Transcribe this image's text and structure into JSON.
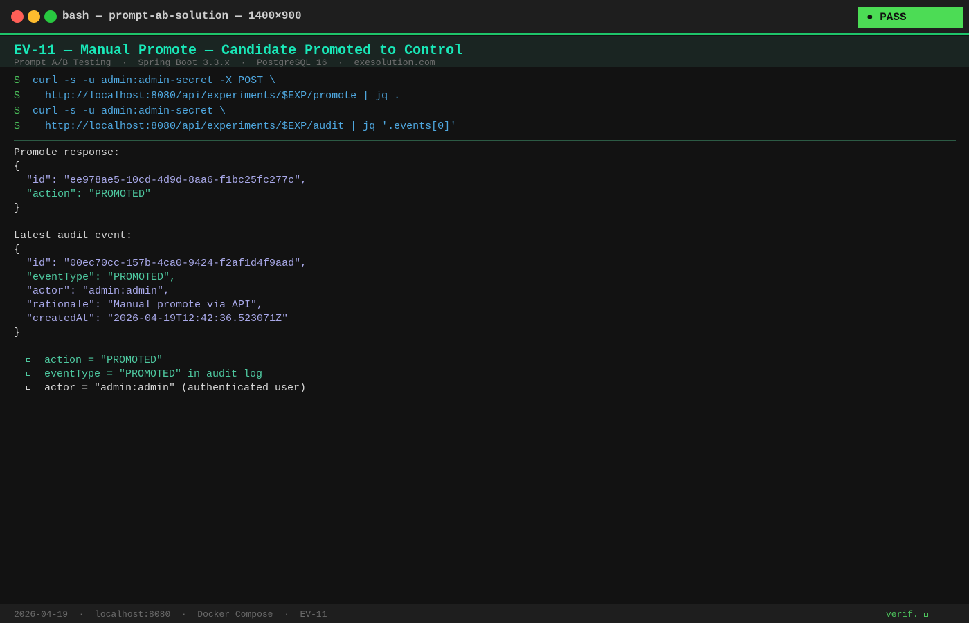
{
  "window": {
    "title": "bash — prompt-ab-solution — 1400×900",
    "status": "PASS"
  },
  "header": {
    "title": "EV-11 — Manual Promote — Candidate Promoted to Control",
    "subtitle": [
      "Prompt A/B Testing",
      "Spring Boot 3.3.x",
      "PostgreSQL 16",
      "exesolution.com"
    ]
  },
  "commands": [
    "curl -s -u admin:admin-secret -X POST \\",
    "  http://localhost:8080/api/experiments/$EXP/promote | jq .",
    "curl -s -u admin:admin-secret \\",
    "  http://localhost:8080/api/experiments/$EXP/audit | jq '.events[0]'"
  ],
  "promote": {
    "label": "Promote response:",
    "open": "{",
    "id_line": "  \"id\": \"ee978ae5-10cd-4d9d-8aa6-f1bc25fc277c\",",
    "action_line": "  \"action\": \"PROMOTED\"",
    "close": "}"
  },
  "audit": {
    "label": "Latest audit event:",
    "open": "{",
    "id_line": "  \"id\": \"00ec70cc-157b-4ca0-9424-f2af1d4f9aad\",",
    "eventType_line": "  \"eventType\": \"PROMOTED\",",
    "actor_line": "  \"actor\": \"admin:admin\",",
    "rationale_line": "  \"rationale\": \"Manual promote via API\",",
    "createdAt_line": "  \"createdAt\": \"2026-04-19T12:42:36.523071Z\"",
    "close": "}"
  },
  "checks": [
    "action = \"PROMOTED\"",
    "eventType = \"PROMOTED\" in audit log",
    "actor = \"admin:admin\" (authenticated user)"
  ],
  "footer": {
    "items": [
      "2026-04-19",
      "localhost:8080",
      "Docker Compose",
      "EV-11"
    ],
    "verif": "verif."
  },
  "colors": {
    "accent": "#19e8b8",
    "pass": "#4cdc55",
    "prompt": "#4cc35c",
    "command": "#4fa8e0"
  }
}
